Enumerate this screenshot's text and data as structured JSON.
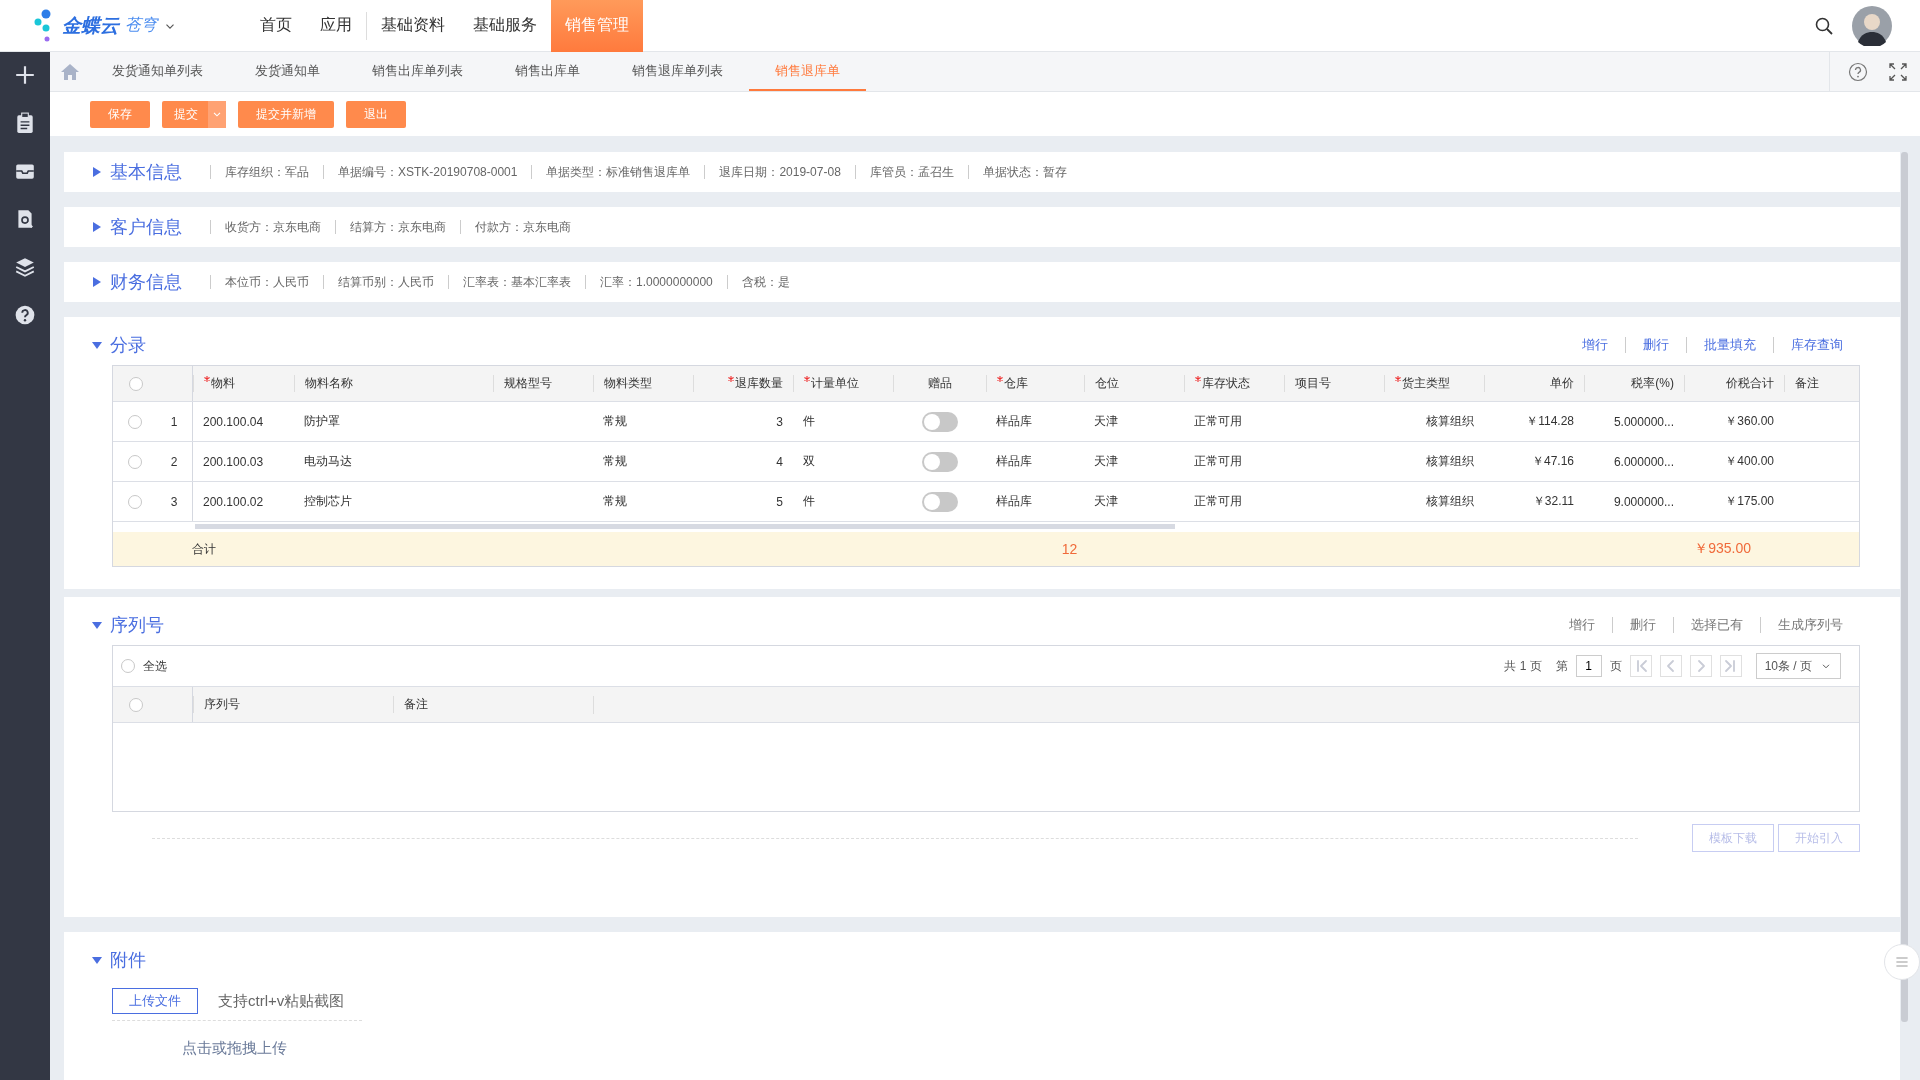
{
  "brand": {
    "name": "金蝶云",
    "product": "苍穹"
  },
  "nav": [
    {
      "label": "首页",
      "selected": false
    },
    {
      "label": "应用",
      "selected": false
    },
    {
      "label": "基础资料",
      "selected": false
    },
    {
      "label": "基础服务",
      "selected": false
    },
    {
      "label": "销售管理",
      "selected": true
    }
  ],
  "tabs": [
    {
      "label": "发货通知单列表",
      "selected": false
    },
    {
      "label": "发货通知单",
      "selected": false
    },
    {
      "label": "销售出库单列表",
      "selected": false
    },
    {
      "label": "销售出库单",
      "selected": false
    },
    {
      "label": "销售退库单列表",
      "selected": false
    },
    {
      "label": "销售退库单",
      "selected": true
    }
  ],
  "toolbar": [
    {
      "label": "保存",
      "kind": "plain"
    },
    {
      "label": "提交",
      "kind": "split"
    },
    {
      "label": "提交并新增",
      "kind": "plain"
    },
    {
      "label": "退出",
      "kind": "plain"
    }
  ],
  "info_sections": [
    {
      "title": "基本信息",
      "expanded": false,
      "fields": [
        "库存组织：军品",
        "单据编号：XSTK-20190708-0001",
        "单据类型：标准销售退库单",
        "退库日期：2019-07-08",
        "库管员：孟召生",
        "单据状态：暂存"
      ]
    },
    {
      "title": "客户信息",
      "expanded": false,
      "fields": [
        "收货方：京东电商",
        "结算方：京东电商",
        "付款方：京东电商"
      ]
    },
    {
      "title": "财务信息",
      "expanded": false,
      "fields": [
        "本位币：人民币",
        "结算币别：人民币",
        "汇率表：基本汇率表",
        "汇率：1.0000000000",
        "含税：是"
      ]
    }
  ],
  "entries": {
    "title": "分录",
    "expanded": true,
    "select_all_checked": false,
    "actions": [
      "增行",
      "删行",
      "批量填充",
      "库存查询"
    ],
    "columns": [
      {
        "label": "物料",
        "required": true
      },
      {
        "label": "物料名称",
        "required": false
      },
      {
        "label": "规格型号",
        "required": false
      },
      {
        "label": "物料类型",
        "required": false
      },
      {
        "label": "退库数量",
        "required": true
      },
      {
        "label": "计量单位",
        "required": true
      },
      {
        "label": "赠品",
        "required": false
      },
      {
        "label": "仓库",
        "required": true
      },
      {
        "label": "仓位",
        "required": false
      },
      {
        "label": "库存状态",
        "required": true
      },
      {
        "label": "项目号",
        "required": false
      },
      {
        "label": "货主类型",
        "required": true
      },
      {
        "label": "单价",
        "required": false
      },
      {
        "label": "税率(%)",
        "required": false
      },
      {
        "label": "价税合计",
        "required": false
      },
      {
        "label": "备注",
        "required": false
      }
    ],
    "rows": [
      {
        "index": "1",
        "selected": false,
        "material": "200.100.04",
        "name": "防护罩",
        "type": "常规",
        "qty": "3",
        "unit": "件",
        "gift": false,
        "warehouse": "样品库",
        "location": "天津",
        "status": "正常可用",
        "owner_type": "核算组织",
        "price": "￥114.28",
        "tax_rate": "5.000000...",
        "amount": "￥360.00"
      },
      {
        "index": "2",
        "selected": false,
        "material": "200.100.03",
        "name": "电动马达",
        "type": "常规",
        "qty": "4",
        "unit": "双",
        "gift": false,
        "warehouse": "样品库",
        "location": "天津",
        "status": "正常可用",
        "owner_type": "核算组织",
        "price": "￥47.16",
        "tax_rate": "6.000000...",
        "amount": "￥400.00"
      },
      {
        "index": "3",
        "selected": false,
        "material": "200.100.02",
        "name": "控制芯片",
        "type": "常规",
        "qty": "5",
        "unit": "件",
        "gift": false,
        "warehouse": "样品库",
        "location": "天津",
        "status": "正常可用",
        "owner_type": "核算组织",
        "price": "￥32.11",
        "tax_rate": "9.000000...",
        "amount": "￥175.00"
      }
    ],
    "total": {
      "label": "合计",
      "qty": "12",
      "amount": "￥935.00"
    }
  },
  "serials": {
    "title": "序列号",
    "expanded": true,
    "actions": [
      "增行",
      "删行",
      "选择已有",
      "生成序列号"
    ],
    "select_all": {
      "label": "全选",
      "checked": false
    },
    "pager": {
      "total": "共 1 页",
      "page_prefix": "第",
      "page": "1",
      "page_suffix": "页",
      "page_size": "10条 / 页"
    },
    "header_checked": false,
    "columns": [
      "序列号",
      "备注"
    ],
    "buttons": [
      {
        "label": "模板下载",
        "disabled": true
      },
      {
        "label": "开始引入",
        "disabled": true
      }
    ]
  },
  "attachments": {
    "title": "附件",
    "expanded": true,
    "upload": "上传文件",
    "paste_hint": "支持ctrl+v粘贴截图",
    "drop_hint": "点击或拖拽上传"
  }
}
